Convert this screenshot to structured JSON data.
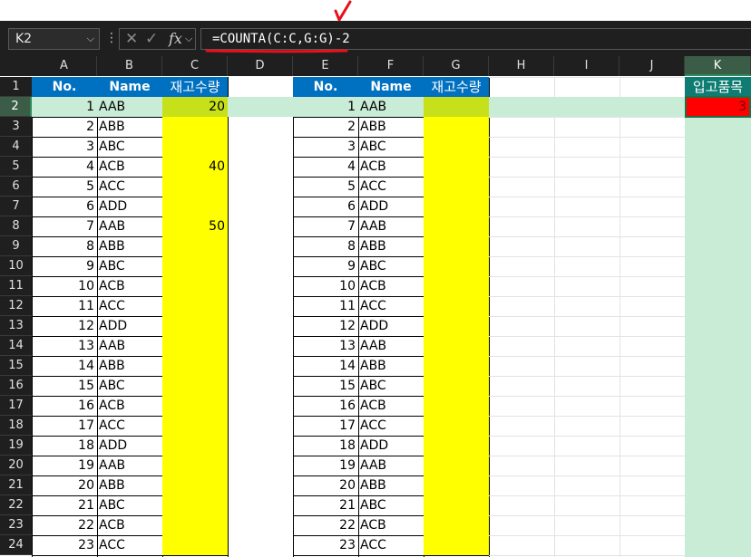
{
  "toolbar": {
    "name_box": "K2",
    "name_box_chevron": "chevron-down-icon",
    "more_icon": "vertical-dots-icon",
    "cancel_icon": "✕",
    "enter_icon": "✓",
    "fx_icon": "fx",
    "formula": "=COUNTA(C:C,G:G)-2"
  },
  "columns": [
    "A",
    "B",
    "C",
    "D",
    "E",
    "F",
    "G",
    "H",
    "I",
    "J",
    "K"
  ],
  "rows": [
    "1",
    "2",
    "3",
    "4",
    "5",
    "6",
    "7",
    "8",
    "9",
    "10",
    "11",
    "12",
    "13",
    "14",
    "15",
    "16",
    "17",
    "18",
    "19",
    "20",
    "21",
    "22",
    "23",
    "24"
  ],
  "selected_cell": "K2",
  "headers": {
    "A": "No.",
    "B": "Name",
    "C": "재고수량",
    "E": "No.",
    "F": "Name",
    "G": "재고수량",
    "K": "입고품목"
  },
  "table1": {
    "no": [
      "1",
      "2",
      "3",
      "4",
      "5",
      "6",
      "7",
      "8",
      "9",
      "10",
      "11",
      "12",
      "13",
      "14",
      "15",
      "16",
      "17",
      "18",
      "19",
      "20",
      "21",
      "22",
      "23"
    ],
    "name": [
      "AAB",
      "ABB",
      "ABC",
      "ACB",
      "ACC",
      "ADD",
      "AAB",
      "ABB",
      "ABC",
      "ACB",
      "ACC",
      "ADD",
      "AAB",
      "ABB",
      "ABC",
      "ACB",
      "ACC",
      "ADD",
      "AAB",
      "ABB",
      "ABC",
      "ACB",
      "ACC"
    ],
    "stock": [
      "20",
      "",
      "",
      "40",
      "",
      "",
      "50",
      "",
      "",
      "",
      "",
      "",
      "",
      "",
      "",
      "",
      "",
      "",
      "",
      "",
      "",
      "",
      ""
    ]
  },
  "table2": {
    "no": [
      "1",
      "2",
      "3",
      "4",
      "5",
      "6",
      "7",
      "8",
      "9",
      "10",
      "11",
      "12",
      "13",
      "14",
      "15",
      "16",
      "17",
      "18",
      "19",
      "20",
      "21",
      "22",
      "23"
    ],
    "name": [
      "AAB",
      "ABB",
      "ABC",
      "ACB",
      "ACC",
      "ADD",
      "AAB",
      "ABB",
      "ABC",
      "ACB",
      "ACC",
      "ADD",
      "AAB",
      "ABB",
      "ABC",
      "ACB",
      "ACC",
      "ADD",
      "AAB",
      "ABB",
      "ABC",
      "ACB",
      "ACC"
    ],
    "stock": [
      "",
      "",
      "",
      "",
      "",
      "",
      "",
      "",
      "",
      "",
      "",
      "",
      "",
      "",
      "",
      "",
      "",
      "",
      "",
      "",
      "",
      "",
      ""
    ]
  },
  "k2_value": "3",
  "colors": {
    "header_blue": "#0070c0",
    "stock_yellow": "#ffff00",
    "active_row_green": "#c9ecd7",
    "active_stock_green": "#c6e01a",
    "k2_red": "#ff0000",
    "annotation_red": "#e8101a"
  }
}
